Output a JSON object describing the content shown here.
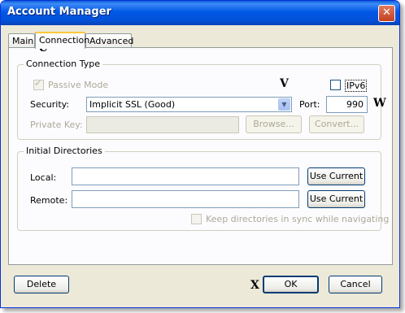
{
  "window": {
    "title": "Account Manager"
  },
  "tabs": [
    {
      "label": "Main"
    },
    {
      "label": "Connection"
    },
    {
      "label": "Advanced"
    }
  ],
  "connection_type": {
    "group_title": "Connection Type",
    "passive_mode": {
      "label": "Passive Mode",
      "checked": true,
      "enabled": false
    },
    "ipv6": {
      "label": "IPv6",
      "checked": false
    },
    "security": {
      "label": "Security:",
      "value": "Implicit SSL (Good)"
    },
    "port": {
      "label": "Port:",
      "value": "990"
    },
    "private_key": {
      "label": "Private Key:",
      "value": ""
    },
    "browse_button": "Browse...",
    "convert_button": "Convert..."
  },
  "initial_directories": {
    "group_title": "Initial Directories",
    "local": {
      "label": "Local:",
      "value": ""
    },
    "remote": {
      "label": "Remote:",
      "value": ""
    },
    "use_current_label": "Use Current",
    "keep_sync": {
      "label": "Keep directories in sync while navigating",
      "checked": false,
      "enabled": false
    }
  },
  "footer": {
    "delete_label": "Delete",
    "ok_label": "OK",
    "cancel_label": "Cancel"
  },
  "annotations": {
    "u": "U",
    "v": "V",
    "w": "W",
    "x": "X"
  }
}
